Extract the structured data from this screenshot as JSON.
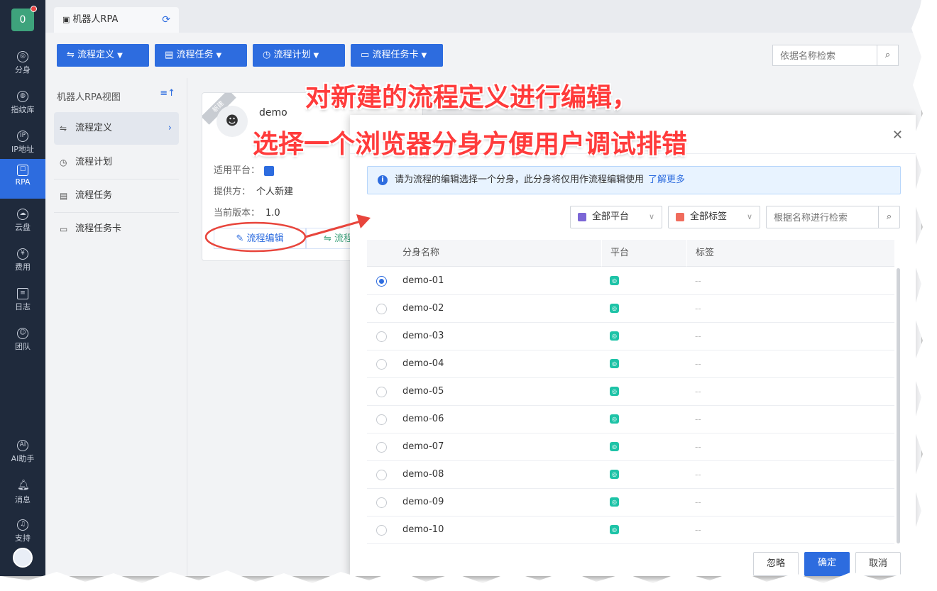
{
  "leftnav": {
    "badge": "0",
    "items": [
      {
        "label": "分身",
        "icon": "chrome-icon"
      },
      {
        "label": "指纹库",
        "icon": "fingerprint-icon"
      },
      {
        "label": "IP地址",
        "icon": "ip-icon"
      },
      {
        "label": "RPA",
        "icon": "robot-icon"
      },
      {
        "label": "云盘",
        "icon": "cloud-drive-icon"
      },
      {
        "label": "费用",
        "icon": "yen-icon"
      },
      {
        "label": "日志",
        "icon": "log-icon"
      },
      {
        "label": "团队",
        "icon": "team-icon"
      },
      {
        "label": "AI助手",
        "icon": "ai-icon"
      },
      {
        "label": "消息",
        "icon": "bell-icon"
      },
      {
        "label": "支持",
        "icon": "headset-icon"
      }
    ]
  },
  "tabbar": {
    "tab_label": "机器人RPA"
  },
  "toolbar": {
    "buttons": [
      "流程定义",
      "流程任务",
      "流程计划",
      "流程任务卡"
    ],
    "search_placeholder": "依据名称检索"
  },
  "sidepanel": {
    "title": "机器人RPA视图",
    "items": [
      "流程定义",
      "流程计划",
      "流程任务",
      "流程任务卡"
    ]
  },
  "card": {
    "ribbon": "新建",
    "name": "demo",
    "platform_label": "适用平台：",
    "provider_label": "提供方：",
    "provider_value": "个人新建",
    "version_label": "当前版本：",
    "version_value": "1.0",
    "edit_button": "流程编辑",
    "second_button": "流程"
  },
  "annotation": {
    "line1": "对新建的流程定义进行编辑，",
    "line2": "选择一个浏览器分身方便用户调试排错"
  },
  "dialog": {
    "info_text": "请为流程的编辑选择一个分身，此分身将仅用作流程编辑使用",
    "info_link": "了解更多",
    "filter_platform": "全部平台",
    "filter_tag": "全部标签",
    "search_placeholder": "根据名称进行检索",
    "columns": [
      "分身名称",
      "平台",
      "标签"
    ],
    "rows": [
      {
        "name": "demo-01",
        "tag": "--",
        "selected": true
      },
      {
        "name": "demo-02",
        "tag": "--",
        "selected": false
      },
      {
        "name": "demo-03",
        "tag": "--",
        "selected": false
      },
      {
        "name": "demo-04",
        "tag": "--",
        "selected": false
      },
      {
        "name": "demo-05",
        "tag": "--",
        "selected": false
      },
      {
        "name": "demo-06",
        "tag": "--",
        "selected": false
      },
      {
        "name": "demo-07",
        "tag": "--",
        "selected": false
      },
      {
        "name": "demo-08",
        "tag": "--",
        "selected": false
      },
      {
        "name": "demo-09",
        "tag": "--",
        "selected": false
      },
      {
        "name": "demo-10",
        "tag": "--",
        "selected": false
      }
    ],
    "footer": {
      "ignore": "忽略",
      "confirm": "确定",
      "cancel": "取消"
    }
  },
  "colors": {
    "primary": "#2d6cdf",
    "nav_bg": "#1f2a3c",
    "annotation": "#ff3b3b",
    "platform_icon": "#1ec3a7"
  }
}
